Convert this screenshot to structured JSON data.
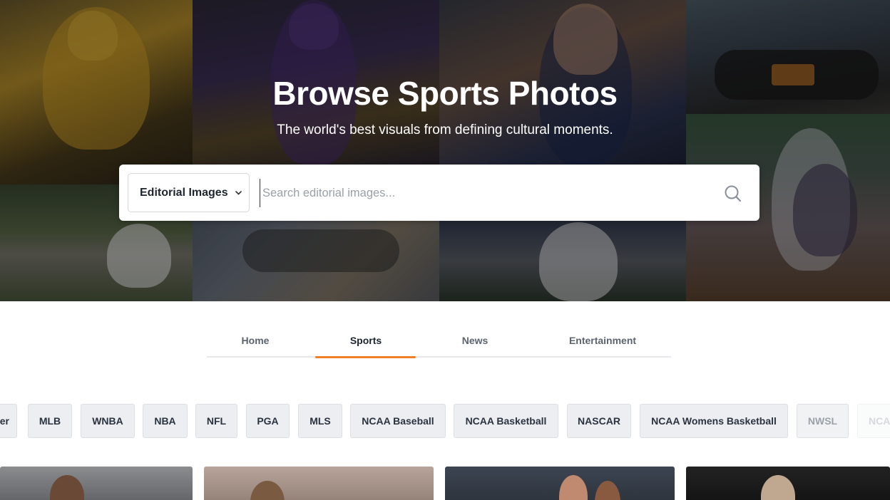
{
  "hero": {
    "title": "Browse Sports Photos",
    "subtitle": "The world's best visuals from defining cultural moments."
  },
  "search": {
    "scope_label": "Editorial Images",
    "placeholder": "Search editorial images...",
    "value": ""
  },
  "tabs": [
    {
      "label": "Home",
      "active": false
    },
    {
      "label": "Sports",
      "active": true
    },
    {
      "label": "News",
      "active": false
    },
    {
      "label": "Entertainment",
      "active": false
    }
  ],
  "categories": [
    "er",
    "MLB",
    "WNBA",
    "NBA",
    "NFL",
    "PGA",
    "MLS",
    "NCAA Baseball",
    "NCAA Basketball",
    "NASCAR",
    "NCAA Womens Basketball",
    "NWSL",
    "NCA"
  ],
  "colors": {
    "accent": "#f07f2a",
    "chip_bg": "#eceef1",
    "text_dark": "#1e2530"
  },
  "icons": {
    "search": "search-icon",
    "dropdown": "chevron-down-icon"
  }
}
